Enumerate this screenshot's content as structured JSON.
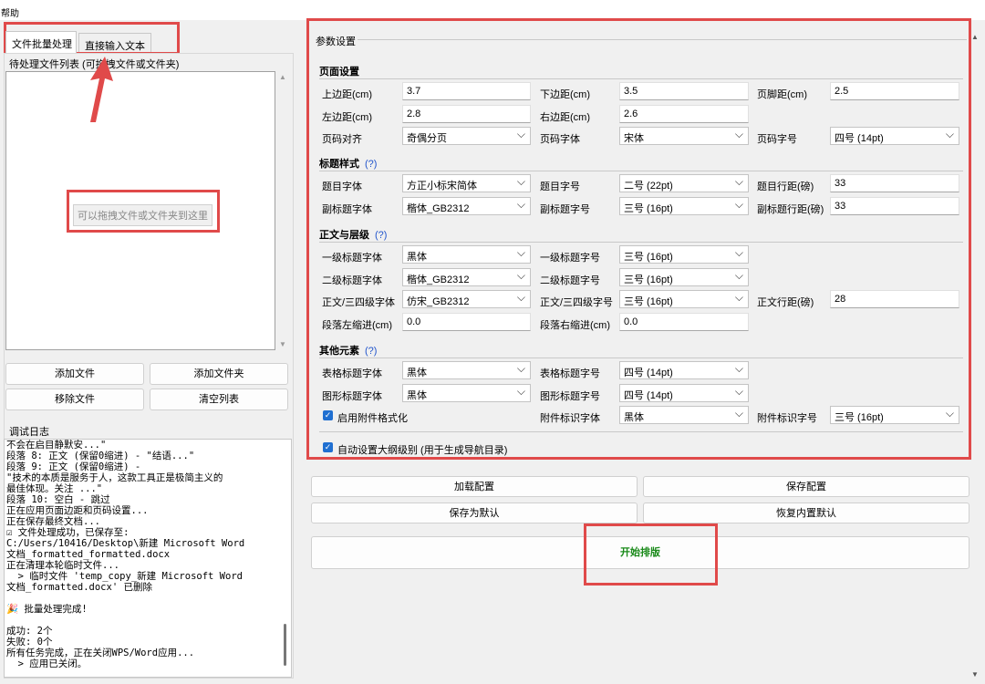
{
  "menu": {
    "help": "帮助"
  },
  "tabs": {
    "batch": "文件批量处理",
    "direct": "直接输入文本"
  },
  "file_list": {
    "title": "待处理文件列表 (可拖拽文件或文件夹)",
    "drop_hint": "可以拖拽文件或文件夹到这里"
  },
  "file_buttons": {
    "add_file": "添加文件",
    "add_folder": "添加文件夹",
    "remove_file": "移除文件",
    "clear_list": "清空列表"
  },
  "debug": {
    "title": "调试日志",
    "lines": [
      "不会在启目静默安...\"",
      "段落 8: 正文 (保留0缩进) - \"结语...\"",
      "段落 9: 正文 (保留0缩进) -",
      "\"技术的本质是服务于人，这款工具正是极简主义的",
      "最佳体现。关注 ...\"",
      "段落 10: 空白 - 跳过",
      "正在应用页面边距和页码设置...",
      "正在保存最终文档...",
      "☑ 文件处理成功，已保存至:",
      "C:/Users/10416/Desktop\\新建 Microsoft Word",
      "文档_formatted_formatted.docx",
      "正在清理本轮临时文件...",
      "  > 临时文件 'temp_copy_新建 Microsoft Word",
      "文档_formatted.docx' 已删除",
      "",
      "🎉 批量处理完成!",
      "",
      "成功: 2个",
      "失败: 0个",
      "所有任务完成，正在关闭WPS/Word应用...",
      "  > 应用已关闭。"
    ]
  },
  "params": {
    "title": "参数设置",
    "page_section": "页面设置",
    "page": {
      "top_margin_label": "上边距(cm)",
      "top_margin": "3.7",
      "bottom_margin_label": "下边距(cm)",
      "bottom_margin": "3.5",
      "footer_distance_label": "页脚距(cm)",
      "footer_distance": "2.5",
      "left_margin_label": "左边距(cm)",
      "left_margin": "2.8",
      "right_margin_label": "右边距(cm)",
      "right_margin": "2.6",
      "pagenum_align_label": "页码对齐",
      "pagenum_align": "奇偶分页",
      "pagenum_font_label": "页码字体",
      "pagenum_font": "宋体",
      "pagenum_size_label": "页码字号",
      "pagenum_size": "四号 (14pt)"
    },
    "title_section": "标题样式",
    "title_help": "(?)",
    "title_style": {
      "title_font_label": "题目字体",
      "title_font": "方正小标宋简体",
      "title_size_label": "题目字号",
      "title_size": "二号 (22pt)",
      "title_spacing_label": "题目行距(磅)",
      "title_spacing": "33",
      "subtitle_font_label": "副标题字体",
      "subtitle_font": "楷体_GB2312",
      "subtitle_size_label": "副标题字号",
      "subtitle_size": "三号 (16pt)",
      "subtitle_spacing_label": "副标题行距(磅)",
      "subtitle_spacing": "33"
    },
    "body_section": "正文与层级",
    "body_help": "(?)",
    "body": {
      "h1_font_label": "一级标题字体",
      "h1_font": "黑体",
      "h1_size_label": "一级标题字号",
      "h1_size": "三号 (16pt)",
      "h2_font_label": "二级标题字体",
      "h2_font": "楷体_GB2312",
      "h2_size_label": "二级标题字号",
      "h2_size": "三号 (16pt)",
      "text_font_label": "正文/三四级字体",
      "text_font": "仿宋_GB2312",
      "text_size_label": "正文/三四级字号",
      "text_size": "三号 (16pt)",
      "text_spacing_label": "正文行距(磅)",
      "text_spacing": "28",
      "left_indent_label": "段落左缩进(cm)",
      "left_indent": "0.0",
      "right_indent_label": "段落右缩进(cm)",
      "right_indent": "0.0"
    },
    "other_section": "其他元素",
    "other_help": "(?)",
    "other": {
      "table_title_font_label": "表格标题字体",
      "table_title_font": "黑体",
      "table_title_size_label": "表格标题字号",
      "table_title_size": "四号 (14pt)",
      "figure_title_font_label": "图形标题字体",
      "figure_title_font": "黑体",
      "figure_title_size_label": "图形标题字号",
      "figure_title_size": "四号 (14pt)",
      "attachment_enable_label": "启用附件格式化",
      "attachment_font_label": "附件标识字体",
      "attachment_font": "黑体",
      "attachment_size_label": "附件标识字号",
      "attachment_size": "三号 (16pt)"
    },
    "auto_outline_label": "自动设置大纲级别 (用于生成导航目录)"
  },
  "actions": {
    "load_config": "加载配置",
    "save_config": "保存配置",
    "save_default": "保存为默认",
    "restore_default": "恢复内置默认",
    "start": "开始排版"
  },
  "colors": {
    "start_text": "#1a8a1a",
    "annotation_red": "#e04a4a"
  }
}
